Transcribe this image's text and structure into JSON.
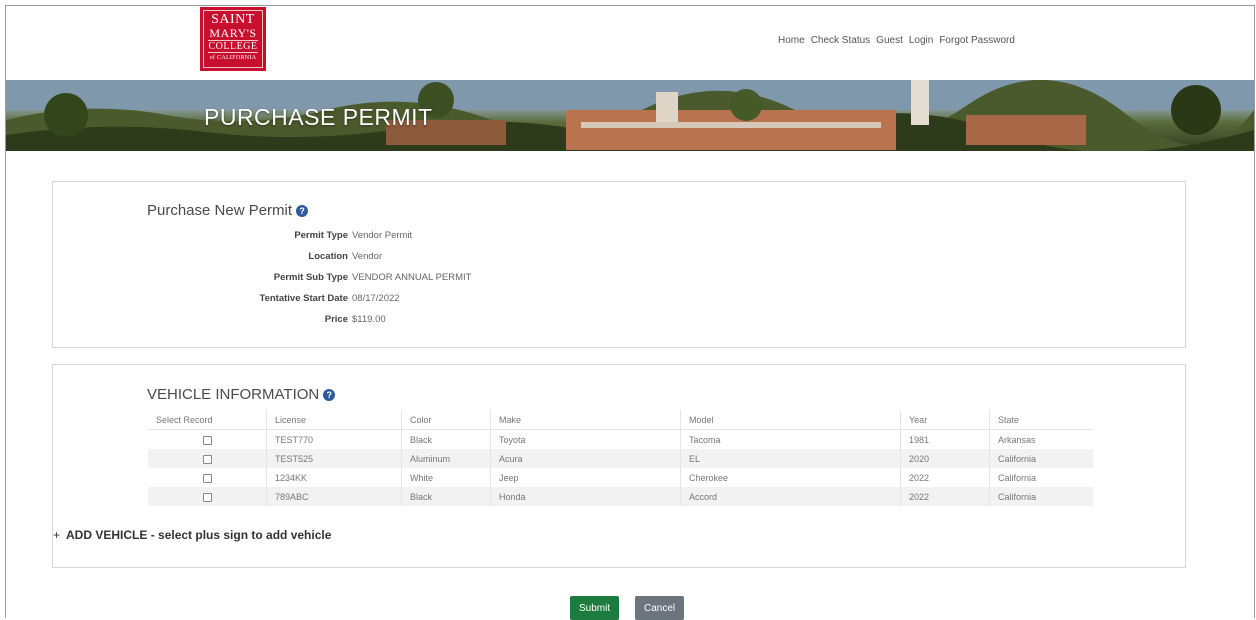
{
  "logo": {
    "line1": "SAINT",
    "line2": "MARY'S",
    "line3": "COLLEGE",
    "line4": "of CALIFORNIA"
  },
  "nav": {
    "items": [
      "Home",
      "Check Status",
      "Guest",
      "Login",
      "Forgot Password"
    ]
  },
  "banner": {
    "title": "PURCHASE PERMIT"
  },
  "permit": {
    "title": "Purchase New Permit",
    "fields": [
      {
        "label": "Permit Type",
        "value": "Vendor Permit"
      },
      {
        "label": "Location",
        "value": "Vendor"
      },
      {
        "label": "Permit Sub Type",
        "value": "VENDOR ANNUAL PERMIT"
      },
      {
        "label": "Tentative Start Date",
        "value": "08/17/2022"
      },
      {
        "label": "Price",
        "value": "$119.00"
      }
    ]
  },
  "vehicles": {
    "title": "VEHICLE INFORMATION",
    "headers": [
      "Select Record",
      "License",
      "Color",
      "Make",
      "Model",
      "Year",
      "State"
    ],
    "rows": [
      [
        "TEST770",
        "Black",
        "Toyota",
        "Tacoma",
        "1981",
        "Arkansas"
      ],
      [
        "TEST525",
        "Aluminum",
        "Acura",
        "EL",
        "2020",
        "California"
      ],
      [
        "1234KK",
        "White",
        "Jeep",
        "Cherokee",
        "2022",
        "California"
      ],
      [
        "789ABC",
        "Black",
        "Honda",
        "Accord",
        "2022",
        "California"
      ]
    ],
    "add_plus": "+",
    "add_label": "ADD VEHICLE - select plus sign to add vehicle"
  },
  "buttons": {
    "submit": "Submit",
    "cancel": "Cancel"
  },
  "colors": {
    "brand_red": "#c8102e",
    "submit_green": "#1e7b3f",
    "cancel_gray": "#6c757d",
    "help_blue": "#2d5b9a"
  }
}
